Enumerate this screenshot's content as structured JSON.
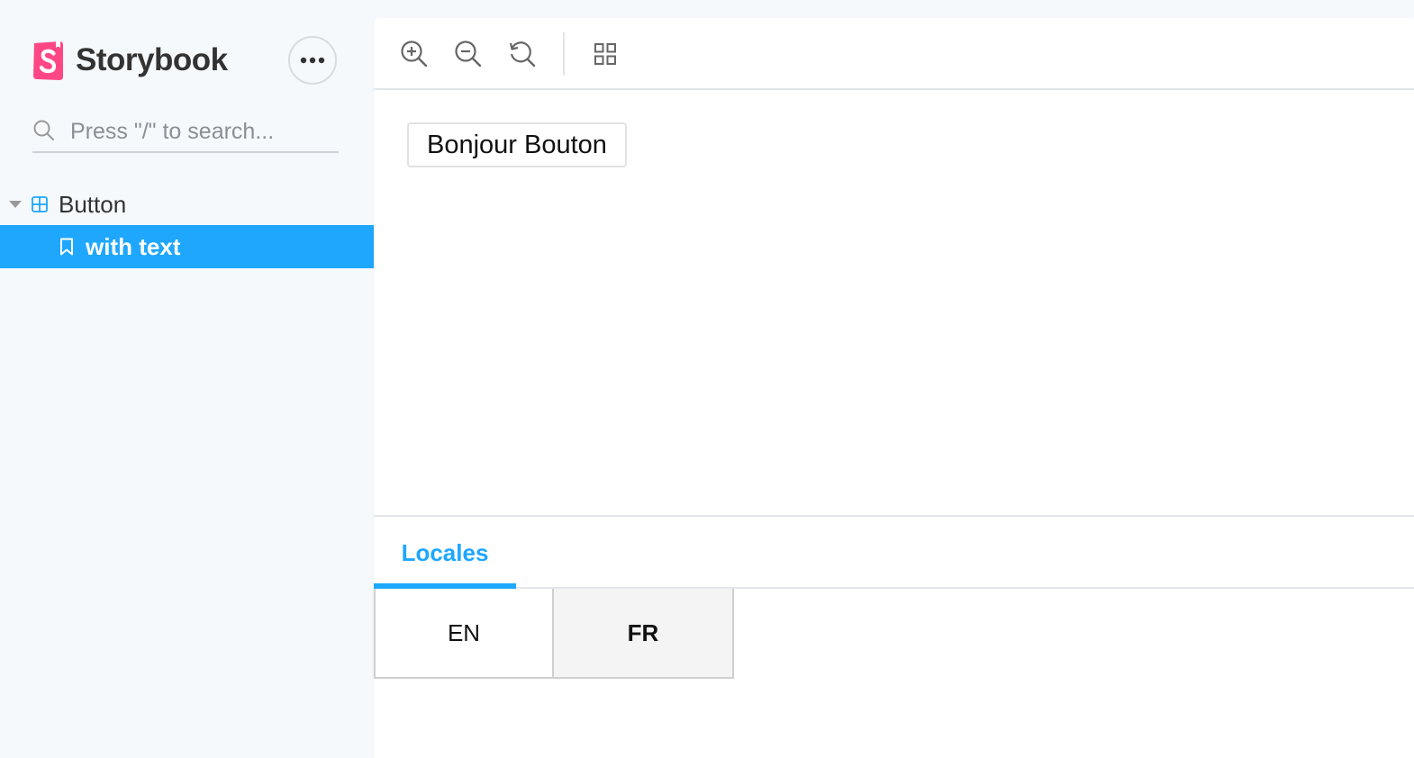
{
  "colors": {
    "accent": "#1ea7fd",
    "brand": "#ff4785",
    "sidebar_bg": "#f6f9fc"
  },
  "sidebar": {
    "brand_name": "Storybook",
    "menu_icon": "ellipsis-icon",
    "search": {
      "placeholder": "Press \"/\" to search...",
      "value": ""
    },
    "tree": {
      "component": {
        "label": "Button",
        "icon": "component-icon",
        "expanded": true
      },
      "story": {
        "label": "with text",
        "icon": "bookmark-icon",
        "selected": true
      }
    }
  },
  "toolbar": {
    "tools": [
      {
        "name": "zoom-in-icon"
      },
      {
        "name": "zoom-out-icon"
      },
      {
        "name": "zoom-reset-icon"
      },
      {
        "name": "grid-icon"
      }
    ]
  },
  "preview": {
    "button_label": "Bonjour Bouton"
  },
  "addons": {
    "tabs": [
      {
        "label": "Locales",
        "active": true
      }
    ],
    "locales": [
      {
        "label": "EN",
        "selected": false
      },
      {
        "label": "FR",
        "selected": true
      }
    ]
  }
}
